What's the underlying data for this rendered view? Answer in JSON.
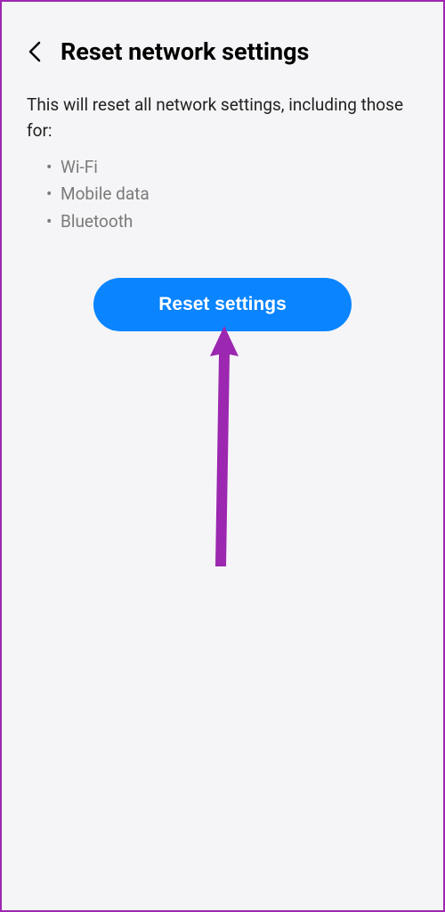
{
  "header": {
    "title": "Reset network settings"
  },
  "description": "This will reset all network settings, including those for:",
  "items": [
    "Wi-Fi",
    "Mobile data",
    "Bluetooth"
  ],
  "button": {
    "label": "Reset settings"
  },
  "colors": {
    "accent": "#0a84ff",
    "annotation": "#9c27b0"
  }
}
